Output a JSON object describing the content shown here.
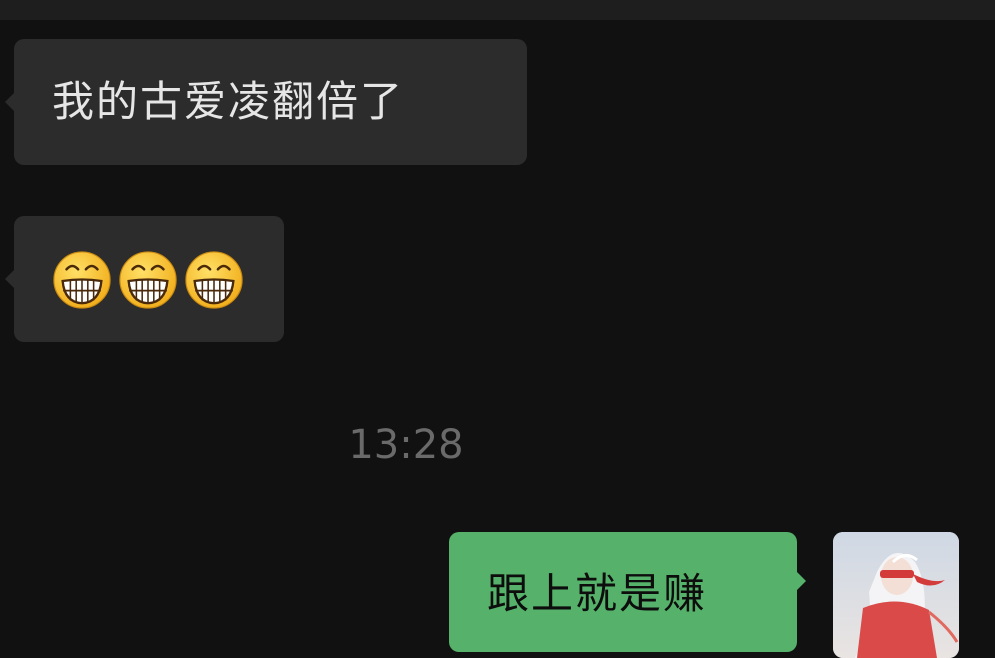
{
  "chat": {
    "messages": [
      {
        "direction": "incoming",
        "text": "我的古爱凌翻倍了"
      },
      {
        "direction": "incoming",
        "emojis": [
          "grinning-face-with-smiling-eyes",
          "grinning-face-with-smiling-eyes",
          "grinning-face-with-smiling-eyes"
        ]
      },
      {
        "direction": "outgoing",
        "text": "跟上就是赚"
      }
    ],
    "timestamp": "13:28"
  },
  "colors": {
    "background": "#111111",
    "top_bar": "#1e1e1e",
    "incoming_bubble": "#2c2c2c",
    "incoming_text": "#e6e6e6",
    "outgoing_bubble": "#56b26a",
    "outgoing_text": "#0d0d0d",
    "timestamp_text": "#6a6a6a"
  }
}
